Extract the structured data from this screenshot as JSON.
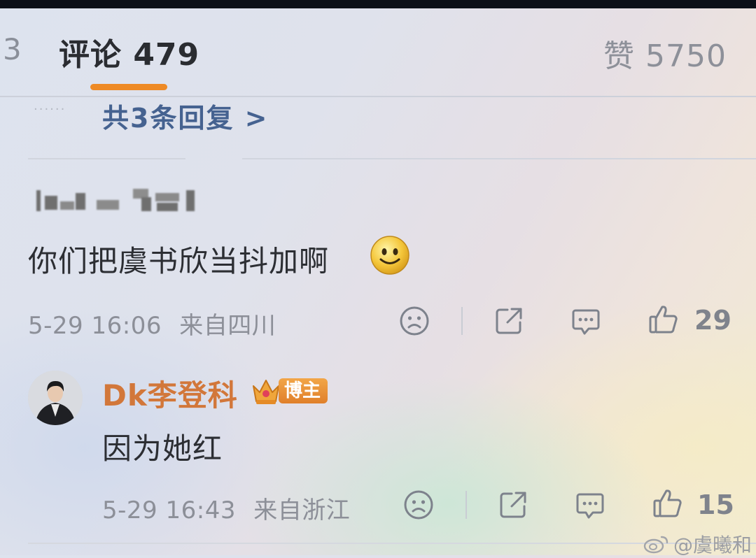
{
  "header": {
    "partial_tab": "3",
    "comments_tab": "评论 479",
    "likes_tab": "赞 5750"
  },
  "thread": {
    "more_replies_link": "共3条回复 >"
  },
  "comment": {
    "text": "你们把虞书欣当抖加啊",
    "emoji": "smiley-emoji-icon",
    "timestamp": "5-29 16:06",
    "location": "来自四川",
    "likes": "29"
  },
  "reply": {
    "author": "Dk李登科",
    "badge": "博主",
    "text": "因为她红",
    "timestamp": "5-29 16:43",
    "location": "来自浙江",
    "likes": "15"
  },
  "watermark": {
    "text": "@虞曦和"
  },
  "colors": {
    "accent_orange": "#ee8a25",
    "link_blue": "#456290",
    "author_orange": "#d2773a",
    "text_dark": "#2c2e33",
    "text_gray": "#8c8f98"
  }
}
